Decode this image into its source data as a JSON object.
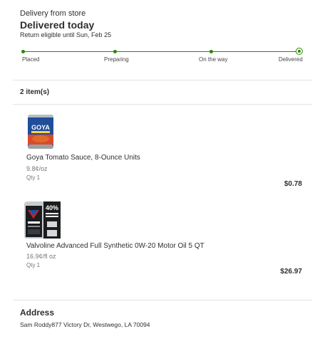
{
  "header": {
    "delivery_label": "Delivery from store",
    "status_title": "Delivered today",
    "return_note": "Return eligible until Sun, Feb 25"
  },
  "tracker": {
    "steps": [
      "Placed",
      "Preparing",
      "On the way",
      "Delivered"
    ],
    "current_step": "Delivered",
    "color": "#2a8703"
  },
  "items": {
    "count_label": "2 item(s)",
    "list": [
      {
        "image_icon": "goya-can-image",
        "name": "Goya Tomato Sauce, 8-Ounce Units",
        "unit_price": "9.8¢/oz",
        "qty": "Qty 1",
        "price": "$0.78",
        "image_text": "GOYA"
      },
      {
        "image_icon": "valvoline-jug-image",
        "name": "Valvoline Advanced Full Synthetic 0W-20 Motor Oil 5 QT",
        "unit_price": "16.9¢/fl oz",
        "qty": "Qty 1",
        "price": "$26.97",
        "image_text": "40%"
      }
    ]
  },
  "address": {
    "title": "Address",
    "line": "Sam Roddy877 Victory Dr, Westwego, LA 70094"
  }
}
